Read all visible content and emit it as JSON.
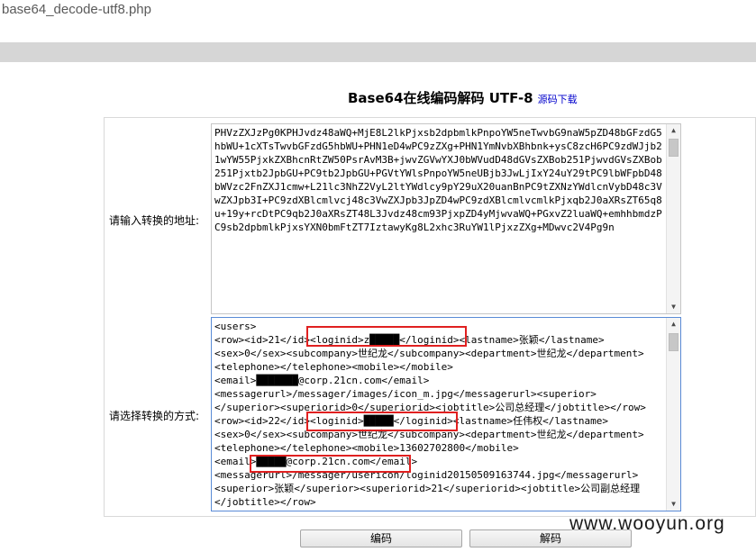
{
  "tab": {
    "title": "base64_decode-utf8.php"
  },
  "heading": {
    "title": "Base64在线编码解码 UTF-8",
    "source_link": "源码下载"
  },
  "form": {
    "input_label": "请输入转换的地址:",
    "method_label": "请选择转换的方式:",
    "input_value": "PHVzZXJzPg0KPHJvdz48aWQ+MjE8L2lkPjxsb2dpbmlkPnpoYW5neTwvbG9naW5pZD48bGFzdG5hbWU+1cXTsTwvbGFzdG5hbWU+PHN1eD4wPC9zZXg+PHN1YmNvbXBhbnk+ysC8zcH6PC9zdWJjb21wYW55PjxkZXBhcnRtZW50PsrAvM3B+jwvZGVwYXJ0bWVudD48dGVsZXBob251PjwvdGVsZXBob251Pjxtb2JpbGU+PC9tb2JpbGU+PGVtYWlsPnpoYW5neUBjb3JwLjIxY24uY29tPC9lbWFpbD48bWVzc2FnZXJ1cmw+L21lc3NhZ2VyL2ltYWdlcy9pY29uX20uanBnPC9tZXNzYWdlcnVybD48c3VwZXJpb3I+PC9zdXBlcmlvcj48c3VwZXJpb3JpZD4wPC9zdXBlcmlvcmlkPjxqb2J0aXRsZT65q8u+19y+rcDtPC9qb2J0aXRsZT48L3Jvdz48cm93PjxpZD4yMjwvaWQ+PGxvZ2luaWQ+emhhbmdzPC9sb2dpbmlkPjxsYXN0bmFtZT7IztawyKg8L2xhc3RuYW1lPjxzZXg+MDwvc2V4Pg9n",
    "output_value": "<users>\n<row><id>21</id><loginid>z█████</loginid><lastname>张颖</lastname>\n<sex>0</sex><subcompany>世纪龙</subcompany><department>世纪龙</department>\n<telephone></telephone><mobile></mobile>\n<email>███████@corp.21cn.com</email>\n<messagerurl>/messager/images/icon_m.jpg</messagerurl><superior>\n</superior><superiorid>0</superiorid><jobtitle>公司总经理</jobtitle></row>\n<row><id>22</id><loginid>█████</loginid><lastname>任伟权</lastname>\n<sex>0</sex><subcompany>世纪龙</subcompany><department>世纪龙</department>\n<telephone></telephone><mobile>13602702800</mobile>\n<email>█████@corp.21cn.com</email>\n<messagerurl>/messager/usericon/loginid20150509163744.jpg</messagerurl>\n<superior>张颖</superior><superiorid>21</superiorid><jobtitle>公司副总经理\n</jobtitle></row>"
  },
  "buttons": {
    "encode": "编码",
    "decode": "解码"
  },
  "watermark": "www.wooyun.org",
  "colors": {
    "highlight": "#e02020",
    "link": "#0000cc"
  }
}
